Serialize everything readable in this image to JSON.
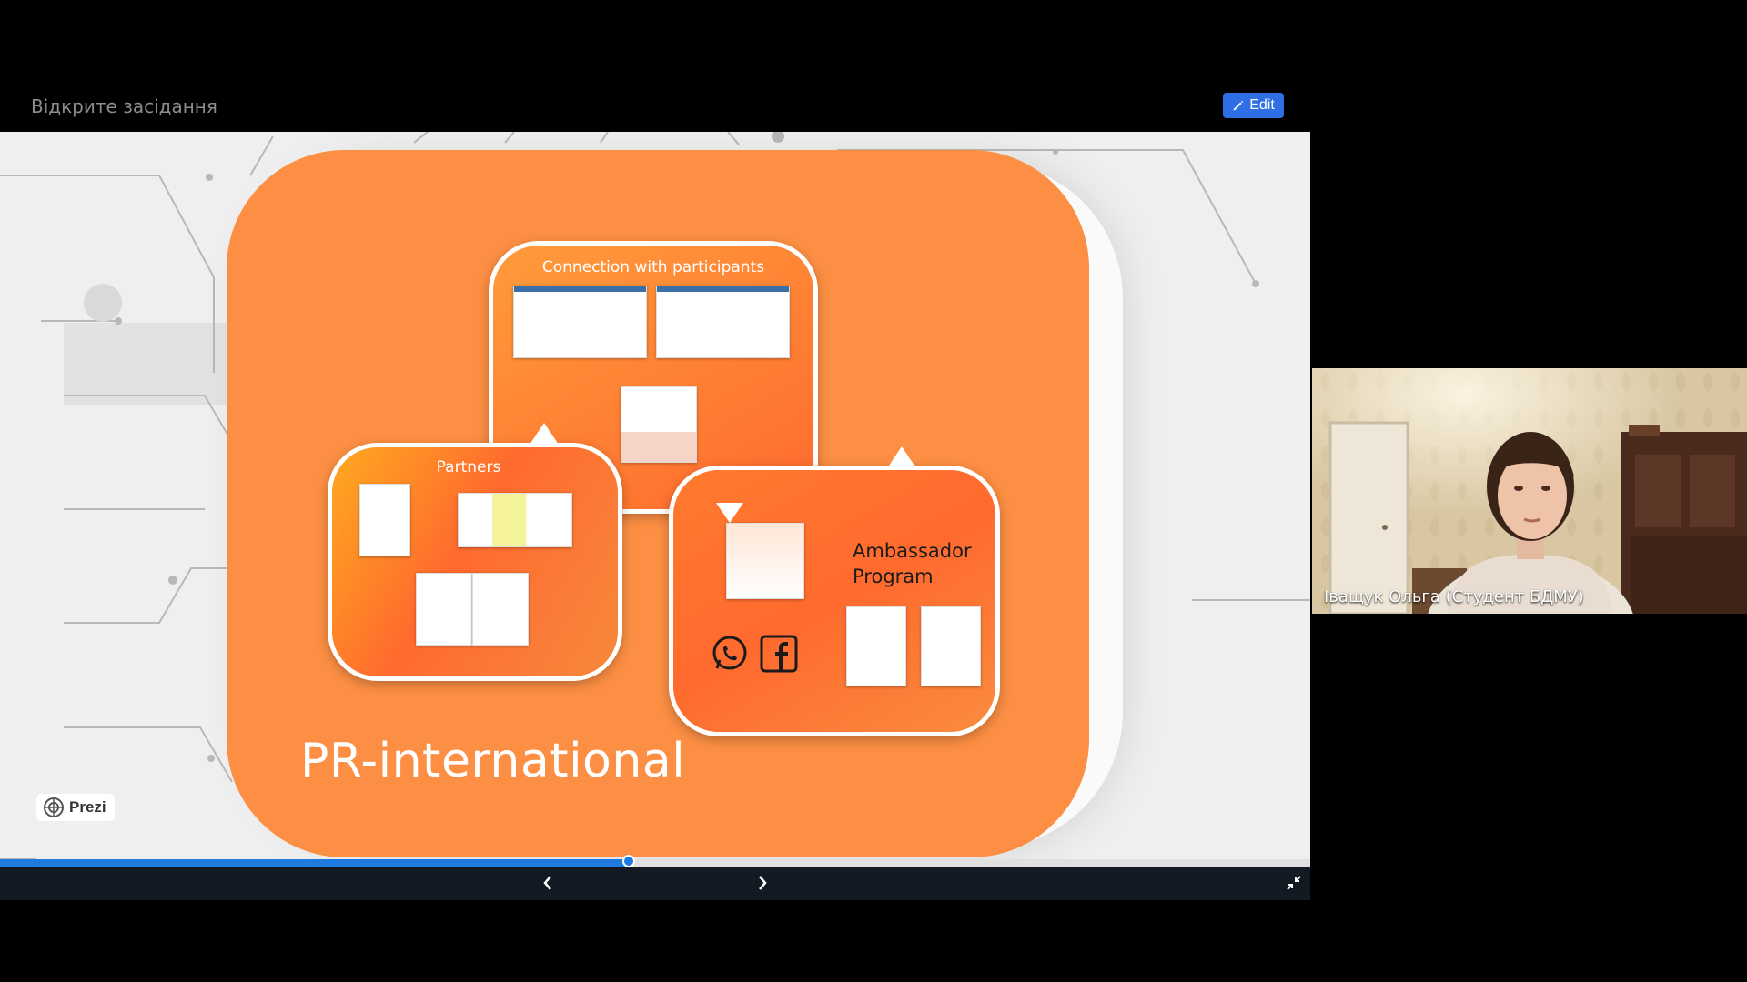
{
  "meeting": {
    "title": "Відкрите засідання",
    "edit_label": "Edit"
  },
  "slide": {
    "title": "PR-international",
    "bubbles": {
      "connection": "Connection with participants",
      "partners": "Partners",
      "ambassador_line1": "Ambassador",
      "ambassador_line2": "Program"
    },
    "brand_badge": "Prezi",
    "accent_color": "#fc8f43"
  },
  "playback": {
    "progress": 0.48,
    "prev_icon": "chevron-left-icon",
    "next_icon": "chevron-right-icon",
    "exit_fullscreen_icon": "minimize-icon"
  },
  "participant": {
    "name": "Іващук Ольга (Студент БДМУ)"
  }
}
